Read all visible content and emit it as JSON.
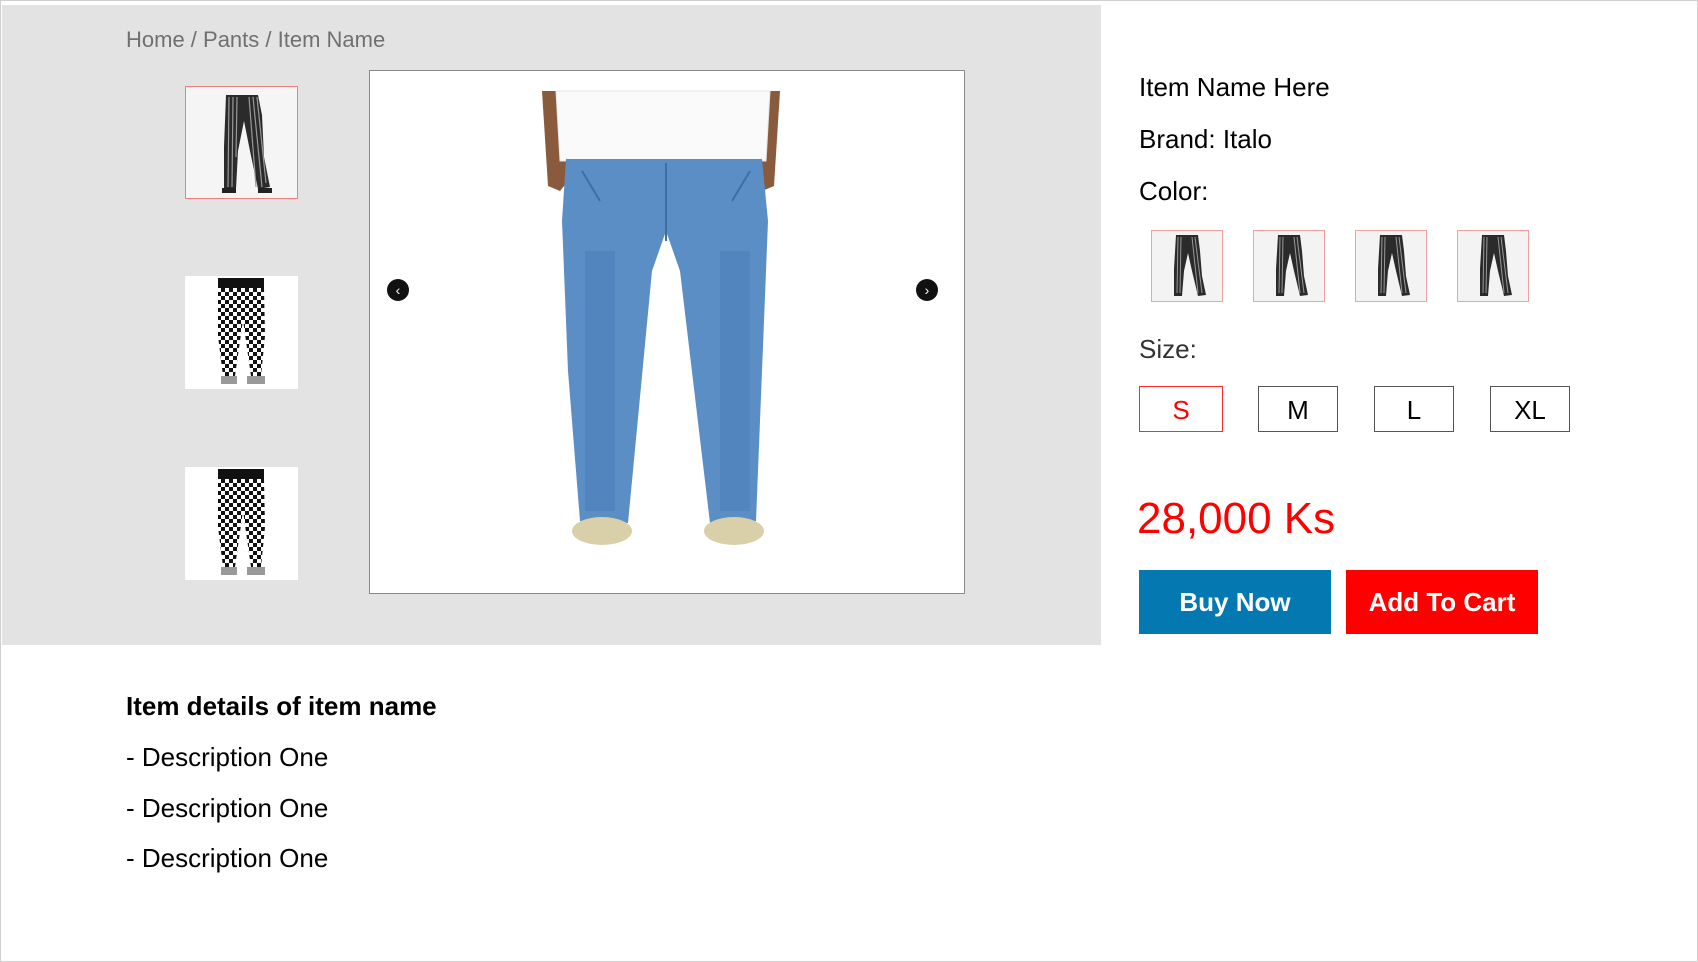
{
  "breadcrumb": "Home / Pants / Item Name",
  "gallery": {
    "prev_icon": "chevron-left-icon",
    "next_icon": "chevron-right-icon",
    "thumbnails": [
      "striped-pants-thumbnail",
      "checkered-pants-thumbnail",
      "checkered-pants-thumbnail"
    ]
  },
  "product": {
    "name": "Item Name Here",
    "brand": "Brand: Italo",
    "color_label": "Color:",
    "size_label": "Size:",
    "sizes": [
      "S",
      "M",
      "L",
      "XL"
    ],
    "selected_size": "S",
    "price": "28,000 Ks",
    "buy_label": "Buy Now",
    "cart_label": "Add To Cart"
  },
  "details": {
    "title": "Item details of item name",
    "lines": [
      "- Description One",
      "- Description One",
      "- Description One"
    ]
  },
  "colors": {
    "accent_red": "#ff0000",
    "buy_blue": "#0478b1",
    "panel_gray": "#e3e3e3"
  }
}
